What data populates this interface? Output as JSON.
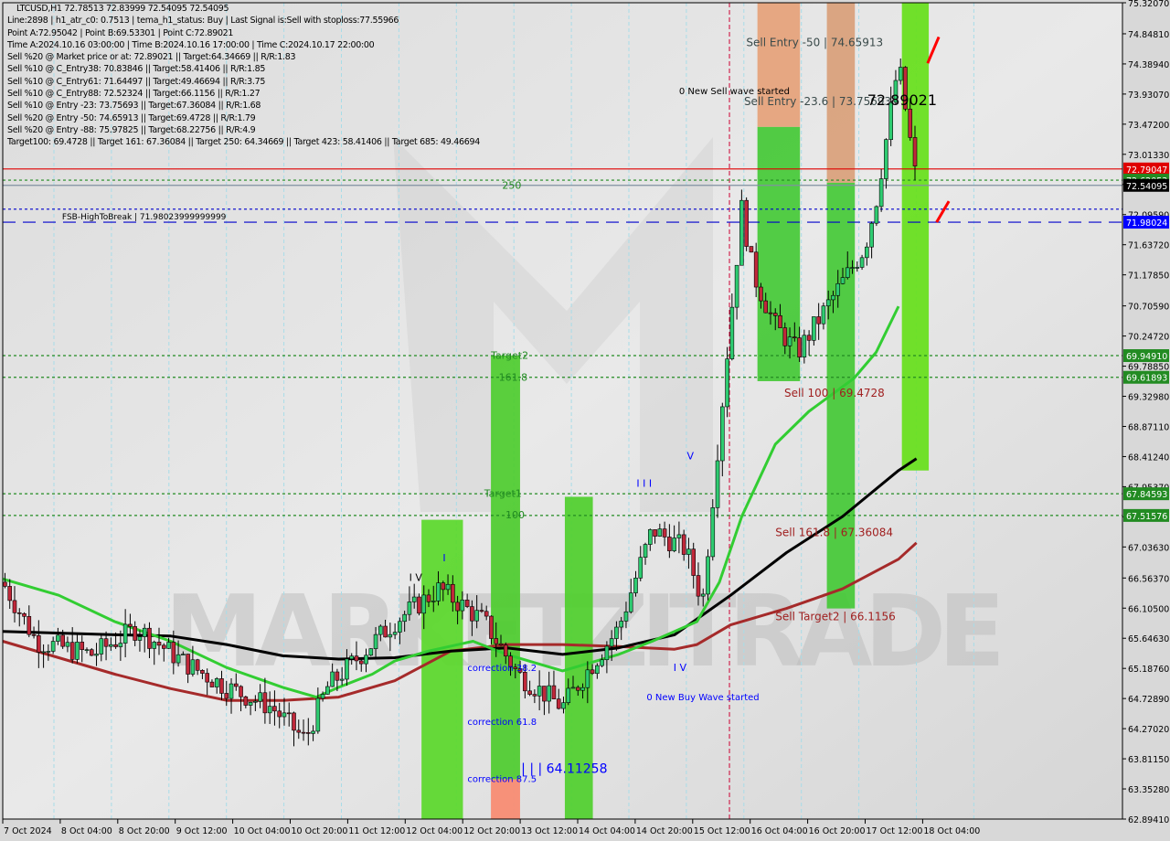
{
  "header": {
    "symbol_line": "LTCUSD,H1  72.78513 72.83999 72.54095 72.54095",
    "info_lines": [
      "Line:2898 | h1_atr_c0: 0.7513 | tema_h1_status: Buy | Last Signal is:Sell with stoploss:77.55966",
      "Point A:72.95042 | Point B:69.53301 | Point C:72.89021",
      "Time A:2024.10.16 03:00:00 | Time B:2024.10.16 17:00:00 | Time C:2024.10.17 22:00:00",
      "Sell %20 @ Market price or at: 72.89021 || Target:64.34669 || R/R:1.83",
      "Sell %10 @ C_Entry38: 70.83846 || Target:58.41406 || R/R:1.85",
      "Sell %10 @ C_Entry61: 71.64497 || Target:49.46694 || R/R:3.75",
      "Sell %10 @ C_Entry88: 72.52324 || Target:66.1156 || R/R:1.27",
      "Sell %10 @ Entry -23: 73.75693 || Target:67.36084 || R/R:1.68",
      "Sell %20 @ Entry -50: 74.65913 || Target:69.4728 || R/R:1.79",
      "Sell %20 @ Entry -88: 75.97825 || Target:68.22756 || R/R:4.9",
      "Target100: 69.4728 || Target 161: 67.36084 || Target 250: 64.34669 || Target 423: 58.41406 || Target 685: 49.46694"
    ]
  },
  "watermark": "MARKETZITRADE",
  "chart_data": {
    "type": "candlestick",
    "title": "LTCUSD,H1",
    "ylim": [
      62.8941,
      75.3207
    ],
    "y_ticks": [
      "75.32070",
      "74.84810",
      "74.38940",
      "73.93070",
      "73.47200",
      "73.01330",
      "72.55460",
      "72.09590",
      "71.63720",
      "71.17850",
      "70.70590",
      "70.24720",
      "69.78850",
      "69.32980",
      "68.87110",
      "68.41240",
      "67.95370",
      "67.49500",
      "67.03630",
      "66.56370",
      "66.10500",
      "65.64630",
      "65.18760",
      "64.72890",
      "64.27020",
      "63.81150",
      "63.35280",
      "62.89410"
    ],
    "x_ticks": [
      "7 Oct 2024",
      "8 Oct 04:00",
      "8 Oct 20:00",
      "9 Oct 12:00",
      "10 Oct 04:00",
      "10 Oct 20:00",
      "11 Oct 12:00",
      "12 Oct 04:00",
      "12 Oct 20:00",
      "13 Oct 12:00",
      "14 Oct 04:00",
      "14 Oct 20:00",
      "15 Oct 12:00",
      "16 Oct 04:00",
      "16 Oct 20:00",
      "17 Oct 12:00",
      "18 Oct 04:00"
    ],
    "price_labels": [
      {
        "value": 72.79047,
        "text": "72.79047",
        "color": "#e00000"
      },
      {
        "value": 72.62053,
        "text": "72.62053",
        "color": "#228b22"
      },
      {
        "value": 72.54095,
        "text": "72.54095",
        "color": "#000000"
      },
      {
        "value": 71.98024,
        "text": "71.98024",
        "color": "#0000ff"
      },
      {
        "value": 69.9491,
        "text": "69.94910",
        "color": "#228b22"
      },
      {
        "value": 69.61893,
        "text": "69.61893",
        "color": "#228b22"
      },
      {
        "value": 67.84593,
        "text": "67.84593",
        "color": "#228b22"
      },
      {
        "value": 67.51576,
        "text": "67.51576",
        "color": "#228b22"
      }
    ],
    "hlines": [
      {
        "value": 72.79047,
        "color": "#e00000",
        "style": "solid"
      },
      {
        "value": 72.62053,
        "color": "#228b22",
        "style": "dot"
      },
      {
        "value": 72.54095,
        "color": "#8090a0",
        "style": "solid"
      },
      {
        "value": 72.1785,
        "color": "#0000cc",
        "style": "dot"
      },
      {
        "value": 71.98024,
        "color": "#0000cc",
        "style": "dash"
      },
      {
        "value": 69.9491,
        "color": "#228b22",
        "style": "dot"
      },
      {
        "value": 69.61893,
        "color": "#228b22",
        "style": "dot"
      },
      {
        "value": 67.84593,
        "color": "#228b22",
        "style": "dot"
      },
      {
        "value": 67.51576,
        "color": "#228b22",
        "style": "dot"
      }
    ],
    "zones": [
      {
        "x0": 0.374,
        "x1": 0.411,
        "y0": 67.45,
        "y1": 62.89,
        "color": "#5ad82a"
      },
      {
        "x0": 0.436,
        "x1": 0.462,
        "y0": 69.95,
        "y1": 63.5,
        "color": "#4dcc2e"
      },
      {
        "x0": 0.436,
        "x1": 0.462,
        "y0": 63.5,
        "y1": 62.89,
        "color": "#f88a70"
      },
      {
        "x0": 0.502,
        "x1": 0.527,
        "y0": 67.8,
        "y1": 62.89,
        "color": "#4fcf2c"
      },
      {
        "x0": 0.674,
        "x1": 0.712,
        "y0": 75.32,
        "y1": 73.43,
        "color": "#e6a27a"
      },
      {
        "x0": 0.674,
        "x1": 0.712,
        "y0": 73.43,
        "y1": 69.56,
        "color": "#44c936"
      },
      {
        "x0": 0.736,
        "x1": 0.761,
        "y0": 75.32,
        "y1": 72.58,
        "color": "#d9a07a"
      },
      {
        "x0": 0.736,
        "x1": 0.761,
        "y0": 72.58,
        "y1": 66.1,
        "color": "#44c936"
      },
      {
        "x0": 0.803,
        "x1": 0.827,
        "y0": 75.32,
        "y1": 68.2,
        "color": "#66e01a"
      }
    ],
    "annotations": [
      {
        "text": "Sell Entry -50 | 74.65913",
        "x": 0.664,
        "y": 74.65913,
        "color": "#3a4a4a",
        "size": 12
      },
      {
        "text": "Sell Entry -23.6 | 73.75693",
        "x": 0.662,
        "y": 73.76,
        "color": "#3a4a4a",
        "size": 12
      },
      {
        "text": "72.89021",
        "x": 0.772,
        "y": 73.76,
        "color": "#000000",
        "size": 16
      },
      {
        "text": "0 New Sell wave started",
        "x": 0.604,
        "y": 73.93,
        "color": "#000000",
        "size": 10
      },
      {
        "text": "250",
        "x": 0.446,
        "y": 72.49,
        "color": "#228b22",
        "size": 11
      },
      {
        "text": "FSB-HighToBreak | 71.98023999999999",
        "x": 0.053,
        "y": 72.02,
        "color": "#000000",
        "size": 9
      },
      {
        "text": "Target2",
        "x": 0.436,
        "y": 69.9,
        "color": "#228b22",
        "size": 11
      },
      {
        "text": "161.8",
        "x": 0.443,
        "y": 69.57,
        "color": "#228b22",
        "size": 11
      },
      {
        "text": "Target1",
        "x": 0.43,
        "y": 67.8,
        "color": "#228b22",
        "size": 11
      },
      {
        "text": "100",
        "x": 0.449,
        "y": 67.47,
        "color": "#228b22",
        "size": 11
      },
      {
        "text": "Sell 100 | 69.4728",
        "x": 0.698,
        "y": 69.32,
        "color": "#a02020",
        "size": 12
      },
      {
        "text": "Sell 161.8 | 67.36084",
        "x": 0.69,
        "y": 67.2,
        "color": "#a02020",
        "size": 12
      },
      {
        "text": "Sell Target2 | 66.1156",
        "x": 0.69,
        "y": 65.92,
        "color": "#a02020",
        "size": 12
      },
      {
        "text": "correction 38.2",
        "x": 0.415,
        "y": 65.15,
        "color": "#0000ff",
        "size": 10
      },
      {
        "text": "correction 61.8",
        "x": 0.415,
        "y": 64.33,
        "color": "#0000ff",
        "size": 10
      },
      {
        "text": "correction 87.5",
        "x": 0.415,
        "y": 63.46,
        "color": "#0000ff",
        "size": 10
      },
      {
        "text": "| | | 64.11258",
        "x": 0.463,
        "y": 63.6,
        "color": "#0000ff",
        "size": 14
      },
      {
        "text": "0 New Buy Wave started",
        "x": 0.575,
        "y": 64.7,
        "color": "#0000ff",
        "size": 10
      },
      {
        "text": "I V",
        "x": 0.599,
        "y": 65.15,
        "color": "#0000ff",
        "size": 11
      },
      {
        "text": "V",
        "x": 0.611,
        "y": 68.37,
        "color": "#0000ff",
        "size": 11
      },
      {
        "text": "I I I",
        "x": 0.566,
        "y": 67.95,
        "color": "#0000ff",
        "size": 11
      },
      {
        "text": "I",
        "x": 0.393,
        "y": 66.82,
        "color": "#0000ff",
        "size": 11
      },
      {
        "text": "I V",
        "x": 0.363,
        "y": 66.52,
        "color": "#000000",
        "size": 11
      }
    ],
    "vlines": [
      {
        "x": 0.649,
        "color": "#cc0033",
        "style": "dash"
      }
    ],
    "ma_black": [
      [
        0.0,
        65.75
      ],
      [
        0.1,
        65.7
      ],
      [
        0.15,
        65.68
      ],
      [
        0.2,
        65.55
      ],
      [
        0.25,
        65.38
      ],
      [
        0.3,
        65.33
      ],
      [
        0.35,
        65.35
      ],
      [
        0.4,
        65.45
      ],
      [
        0.45,
        65.5
      ],
      [
        0.5,
        65.4
      ],
      [
        0.55,
        65.5
      ],
      [
        0.6,
        65.7
      ],
      [
        0.65,
        66.3
      ],
      [
        0.7,
        66.95
      ],
      [
        0.75,
        67.5
      ],
      [
        0.8,
        68.2
      ],
      [
        0.816,
        68.38
      ]
    ],
    "ma_brown": [
      [
        0.0,
        65.6
      ],
      [
        0.05,
        65.35
      ],
      [
        0.1,
        65.1
      ],
      [
        0.15,
        64.88
      ],
      [
        0.2,
        64.7
      ],
      [
        0.25,
        64.7
      ],
      [
        0.3,
        64.75
      ],
      [
        0.35,
        65.0
      ],
      [
        0.4,
        65.45
      ],
      [
        0.45,
        65.55
      ],
      [
        0.5,
        65.55
      ],
      [
        0.55,
        65.52
      ],
      [
        0.6,
        65.48
      ],
      [
        0.62,
        65.55
      ],
      [
        0.65,
        65.85
      ],
      [
        0.7,
        66.1
      ],
      [
        0.75,
        66.4
      ],
      [
        0.8,
        66.85
      ],
      [
        0.816,
        67.1
      ]
    ],
    "ma_green": [
      [
        0.0,
        66.55
      ],
      [
        0.05,
        66.3
      ],
      [
        0.1,
        65.9
      ],
      [
        0.15,
        65.6
      ],
      [
        0.2,
        65.2
      ],
      [
        0.25,
        64.9
      ],
      [
        0.28,
        64.75
      ],
      [
        0.3,
        64.9
      ],
      [
        0.33,
        65.1
      ],
      [
        0.35,
        65.3
      ],
      [
        0.38,
        65.45
      ],
      [
        0.42,
        65.6
      ],
      [
        0.45,
        65.4
      ],
      [
        0.5,
        65.15
      ],
      [
        0.55,
        65.4
      ],
      [
        0.58,
        65.6
      ],
      [
        0.62,
        65.9
      ],
      [
        0.64,
        66.5
      ],
      [
        0.66,
        67.5
      ],
      [
        0.69,
        68.6
      ],
      [
        0.72,
        69.1
      ],
      [
        0.76,
        69.6
      ],
      [
        0.78,
        70.0
      ],
      [
        0.8,
        70.7
      ]
    ]
  }
}
